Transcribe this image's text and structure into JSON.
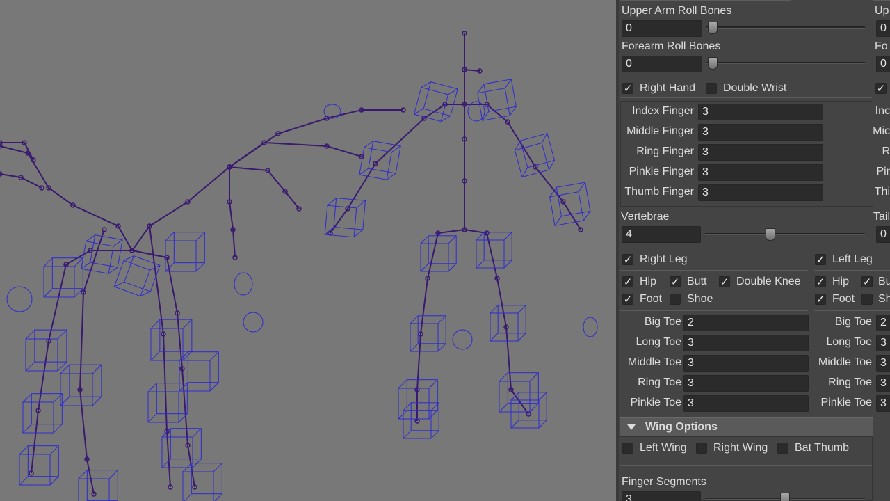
{
  "arm": {
    "upper_arm_roll": {
      "label": "Upper Arm Roll Bones",
      "value": "0",
      "level": 0
    },
    "forearm_roll": {
      "label": "Forearm Roll Bones",
      "value": "0",
      "level": 0
    },
    "cut_right_labels": [
      "Up",
      "Fo"
    ],
    "cut_right_values": [
      "0",
      "0"
    ]
  },
  "hand": {
    "right_hand": {
      "label": "Right Hand",
      "checked": true
    },
    "double_wrist": {
      "label": "Double Wrist",
      "checked": false
    },
    "fingers": [
      {
        "label": "Index Finger",
        "value": "3",
        "cut": "Inc"
      },
      {
        "label": "Middle Finger",
        "value": "3",
        "cut": "Mic"
      },
      {
        "label": "Ring Finger",
        "value": "3",
        "cut": "R"
      },
      {
        "label": "Pinkie Finger",
        "value": "3",
        "cut": "Pir"
      },
      {
        "label": "Thumb Finger",
        "value": "3",
        "cut": "Thi"
      }
    ]
  },
  "spine": {
    "vertebrae": {
      "label": "Vertebrae",
      "value": "4",
      "level": 0.4
    },
    "tail_cut_label": "Tail",
    "tail_cut_value": "0"
  },
  "legs": {
    "right_leg": {
      "label": "Right Leg",
      "checked": true
    },
    "left_leg": {
      "label": "Left Leg",
      "checked": true
    },
    "right_options": [
      {
        "label": "Hip",
        "checked": true
      },
      {
        "label": "Butt",
        "checked": true
      },
      {
        "label": "Double Knee",
        "checked": true
      },
      {
        "label": "Foot",
        "checked": true
      },
      {
        "label": "Shoe",
        "checked": false
      }
    ],
    "left_options": [
      {
        "label": "Hip",
        "checked": true
      },
      {
        "label": "Bu",
        "checked": true
      },
      {
        "label": "Foot",
        "checked": true
      },
      {
        "label": "Sh",
        "checked": false
      }
    ],
    "right_toes": [
      {
        "label": "Big Toe",
        "value": "2"
      },
      {
        "label": "Long Toe",
        "value": "3"
      },
      {
        "label": "Middle Toe",
        "value": "3"
      },
      {
        "label": "Ring Toe",
        "value": "3"
      },
      {
        "label": "Pinkie Toe",
        "value": "3"
      }
    ],
    "left_toes": [
      {
        "label": "Big Toe",
        "value": "2"
      },
      {
        "label": "Long Toe",
        "value": "3"
      },
      {
        "label": "Middle Toe",
        "value": "3"
      },
      {
        "label": "Ring Toe",
        "value": "3"
      },
      {
        "label": "Pinkie Toe",
        "value": "3"
      }
    ]
  },
  "wing": {
    "header": "Wing Options",
    "options": [
      {
        "label": "Left Wing",
        "checked": false
      },
      {
        "label": "Right Wing",
        "checked": false
      },
      {
        "label": "Bat Thumb",
        "checked": false
      }
    ],
    "finger_segments": {
      "label": "Finger Segments",
      "value": "3",
      "level": 0.5
    }
  },
  "colors": {
    "rig_lines": "#3a1a6e",
    "rig_boxes": "#2e2bd0",
    "panel_bg": "#444444",
    "viewport_bg": "#787878"
  },
  "icons": {
    "collapse": "triangle-down-icon",
    "check": "checkmark-icon"
  }
}
